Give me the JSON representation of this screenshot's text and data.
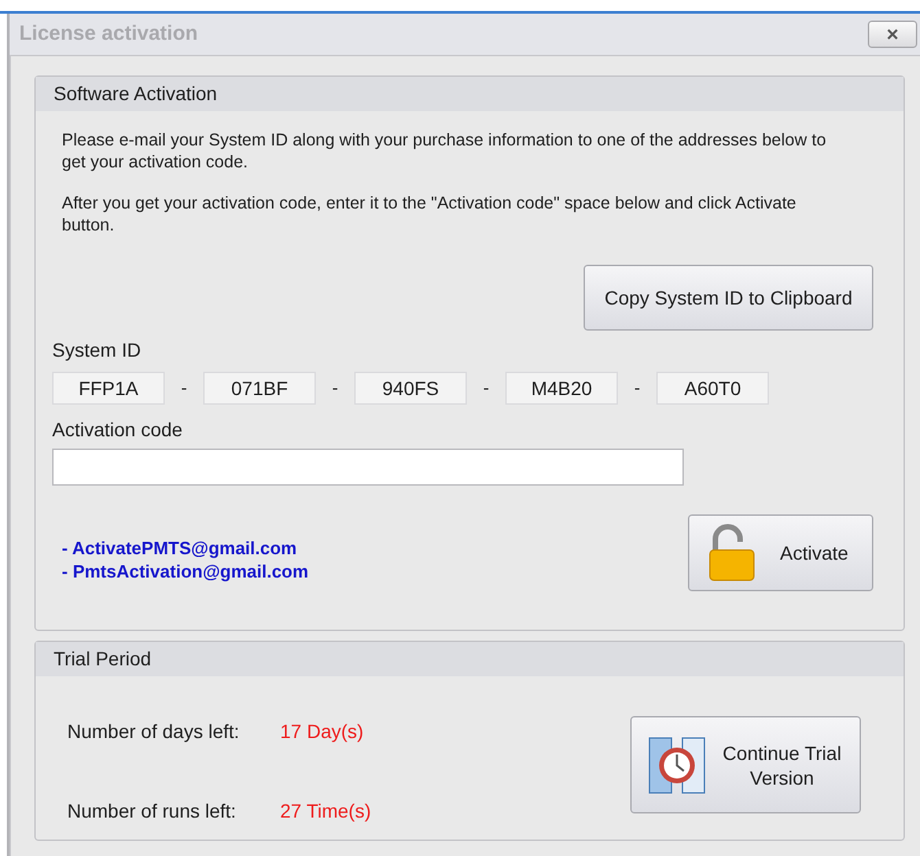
{
  "window": {
    "title": "License activation",
    "close_label": "×"
  },
  "software_activation": {
    "title": "Software Activation",
    "paragraphs": [
      "Please e-mail your System ID along with your purchase information to one of the addresses below to get your activation code.",
      "After you get your activation code, enter it to the \"Activation code\" space below and click Activate button."
    ],
    "copy_button": "Copy System ID to Clipboard",
    "system_id_label": "System ID",
    "system_id_parts": [
      "FFP1A",
      "071BF",
      "940FS",
      "M4B20",
      "A60T0"
    ],
    "separators": [
      "-",
      "-",
      "-",
      "-"
    ],
    "activation_code_label": "Activation code",
    "emails": [
      "- ActivatePMTS@gmail.com",
      "- PmtsActivation@gmail.com"
    ],
    "activate_button": "Activate"
  },
  "trial_period": {
    "title": "Trial Period",
    "rows": [
      {
        "label": "Number of days left:",
        "value": "17 Day(s)"
      },
      {
        "label": "Number of runs left:",
        "value": "27 Time(s)"
      }
    ],
    "continue_button": "Continue Trial Version"
  }
}
